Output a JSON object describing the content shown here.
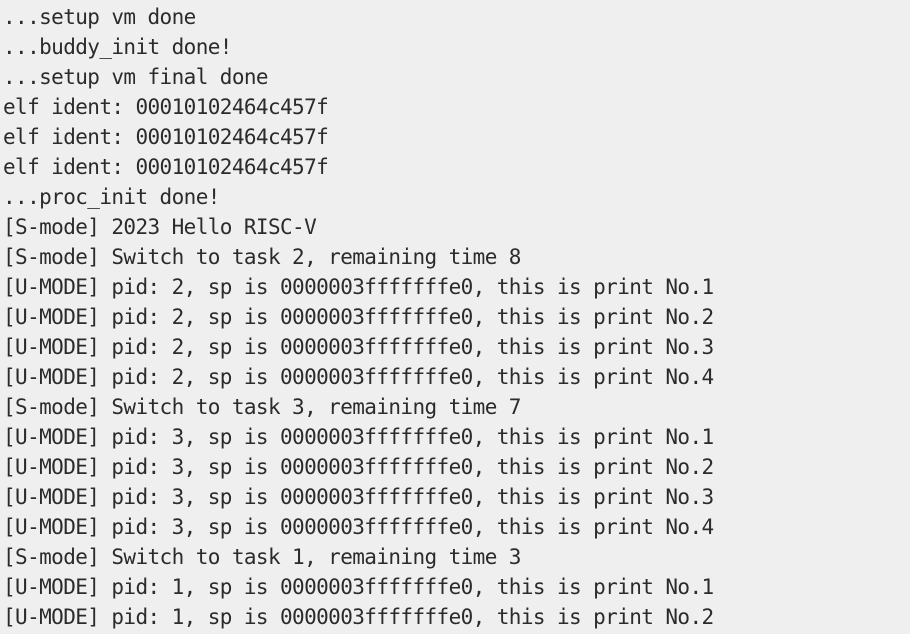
{
  "terminal": {
    "lines": [
      "...setup vm done",
      "...buddy_init done!",
      "...setup vm final done",
      "elf ident: 00010102464c457f",
      "elf ident: 00010102464c457f",
      "elf ident: 00010102464c457f",
      "...proc_init done!",
      "[S-mode] 2023 Hello RISC-V",
      "[S-mode] Switch to task 2, remaining time 8",
      "[U-MODE] pid: 2, sp is 0000003fffffffe0, this is print No.1",
      "[U-MODE] pid: 2, sp is 0000003fffffffe0, this is print No.2",
      "[U-MODE] pid: 2, sp is 0000003fffffffe0, this is print No.3",
      "[U-MODE] pid: 2, sp is 0000003fffffffe0, this is print No.4",
      "[S-mode] Switch to task 3, remaining time 7",
      "[U-MODE] pid: 3, sp is 0000003fffffffe0, this is print No.1",
      "[U-MODE] pid: 3, sp is 0000003fffffffe0, this is print No.2",
      "[U-MODE] pid: 3, sp is 0000003fffffffe0, this is print No.3",
      "[U-MODE] pid: 3, sp is 0000003fffffffe0, this is print No.4",
      "[S-mode] Switch to task 1, remaining time 3",
      "[U-MODE] pid: 1, sp is 0000003fffffffe0, this is print No.1",
      "[U-MODE] pid: 1, sp is 0000003fffffffe0, this is print No.2"
    ]
  }
}
